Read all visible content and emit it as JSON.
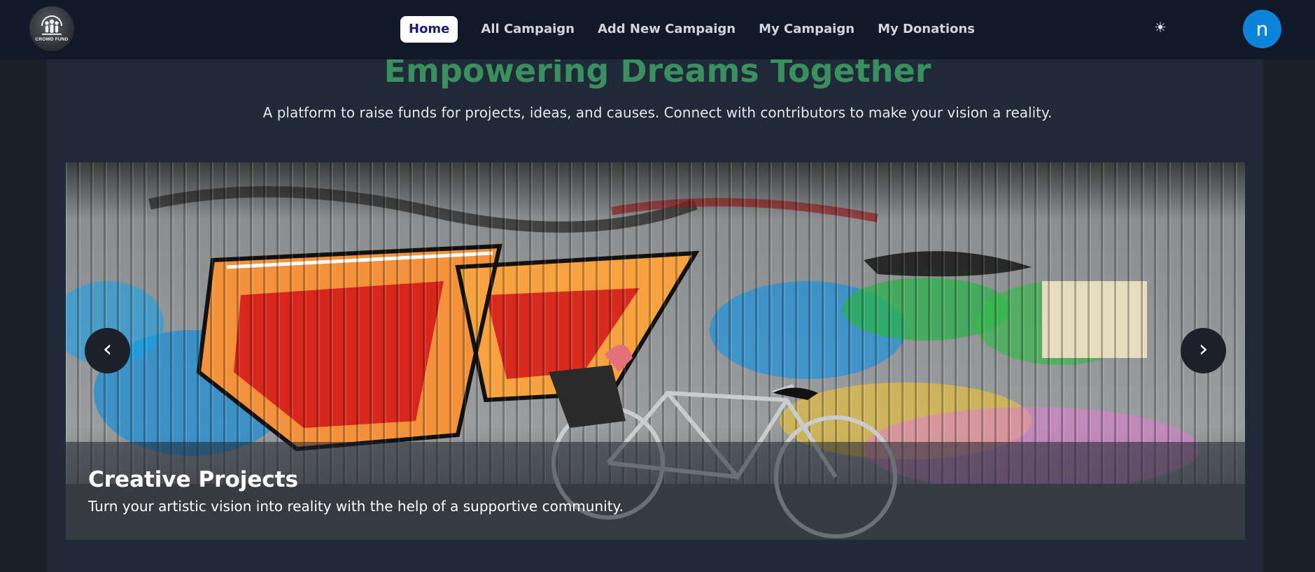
{
  "brand": {
    "logo_text": "CROWD FUND",
    "logo_icon": "crowd-people-icon"
  },
  "nav": {
    "links": [
      {
        "label": "Home",
        "active": true
      },
      {
        "label": "All Campaign",
        "active": false
      },
      {
        "label": "Add New Campaign",
        "active": false
      },
      {
        "label": "My Campaign",
        "active": false
      },
      {
        "label": "My Donations",
        "active": false
      }
    ],
    "theme_toggle_icon": "sun-icon",
    "theme_toggle_glyph": "☀",
    "avatar_initial": "n"
  },
  "hero": {
    "title": "Empowering Dreams Together",
    "subtitle": "A platform to raise funds for projects, ideas, and causes. Connect with contributors to make your vision a reality."
  },
  "carousel": {
    "slide_image": "graffiti-wall-with-bicycle",
    "slide_title": "Creative Projects",
    "slide_text": "Turn your artistic vision into reality with the help of a supportive community.",
    "prev_glyph": "‹",
    "next_glyph": "›"
  },
  "colors": {
    "navbar_bg": "#111827",
    "page_bg": "#1b2027",
    "panel_bg": "#1f2937",
    "title_green": "#3a8f5f",
    "avatar_blue": "#0b84d9",
    "active_link_text": "#1e1b7a"
  }
}
